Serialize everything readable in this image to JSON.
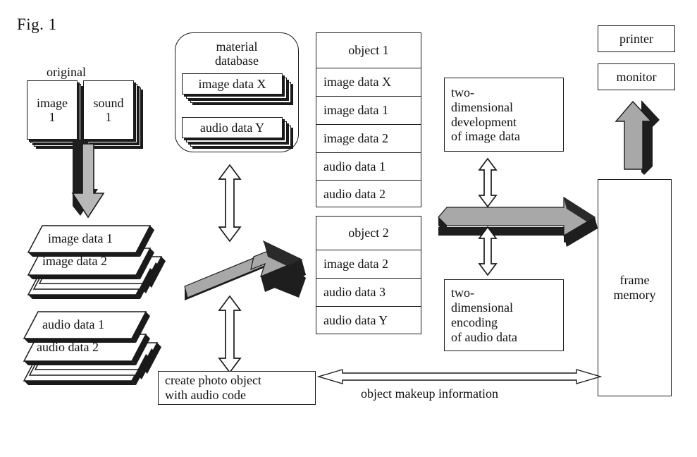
{
  "figure": {
    "label": "Fig. 1"
  },
  "original": {
    "caption": "original",
    "cards": [
      {
        "line1": "image",
        "line2": "1"
      },
      {
        "line1": "sound",
        "line2": "1"
      }
    ]
  },
  "material_database": {
    "title_line1": "material",
    "title_line2": "database",
    "stacks": [
      {
        "label": "image data X"
      },
      {
        "label": "audio data Y"
      }
    ]
  },
  "data_sheets": {
    "image_group": [
      {
        "label": "image data 1"
      },
      {
        "label": "image data 2"
      }
    ],
    "audio_group": [
      {
        "label": "audio data 1"
      },
      {
        "label": "audio data 2"
      }
    ]
  },
  "objects": [
    {
      "header": "object 1",
      "rows": [
        "image data X",
        "image data 1",
        "image data 2",
        "audio data 1",
        "audio data 2"
      ]
    },
    {
      "header": "object 2",
      "rows": [
        "image data 2",
        "audio data 3",
        "audio data Y"
      ]
    }
  ],
  "processes": {
    "development": {
      "line1": "two-",
      "line2": "dimensional",
      "line3": "development",
      "line4": "of image data"
    },
    "encoding": {
      "line1": "two-",
      "line2": "dimensional",
      "line3": "encoding",
      "line4": "of audio data"
    }
  },
  "outputs": {
    "printer": "printer",
    "monitor": "monitor",
    "frame_memory_line1": "frame",
    "frame_memory_line2": "memory"
  },
  "creator": {
    "line1": "create  photo  object",
    "line2": "with audio code"
  },
  "connections": {
    "object_makeup_information": "object makeup information"
  },
  "colors": {
    "stroke": "#1a1a1a",
    "arrow_light": "#a8a8a8",
    "arrow_dark": "#1e1e1e",
    "background": "#ffffff"
  }
}
